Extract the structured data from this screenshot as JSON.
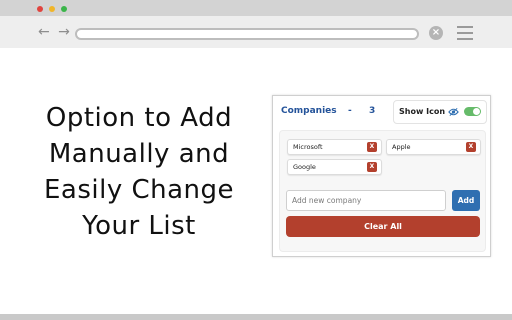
{
  "browser": {
    "nav_arrows": "← →",
    "close_glyph": "×"
  },
  "headline": {
    "lines": [
      "Option to Add",
      "Manually and",
      "Easily Change",
      "Your List"
    ]
  },
  "popup": {
    "title": "Companies",
    "separator": "-",
    "count": "3",
    "show_icon_label": "Show Icon",
    "show_icon_enabled": true,
    "companies": [
      {
        "name": "Microsoft",
        "remove": "X"
      },
      {
        "name": "Apple",
        "remove": "X"
      },
      {
        "name": "Google",
        "remove": "X"
      }
    ],
    "input_placeholder": "Add new company",
    "add_label": "Add",
    "clear_label": "Clear All",
    "colors": {
      "accent_blue": "#2f6fb1",
      "danger_red": "#b3402d",
      "toggle_green": "#66bb6a",
      "title_blue": "#24539a"
    }
  }
}
